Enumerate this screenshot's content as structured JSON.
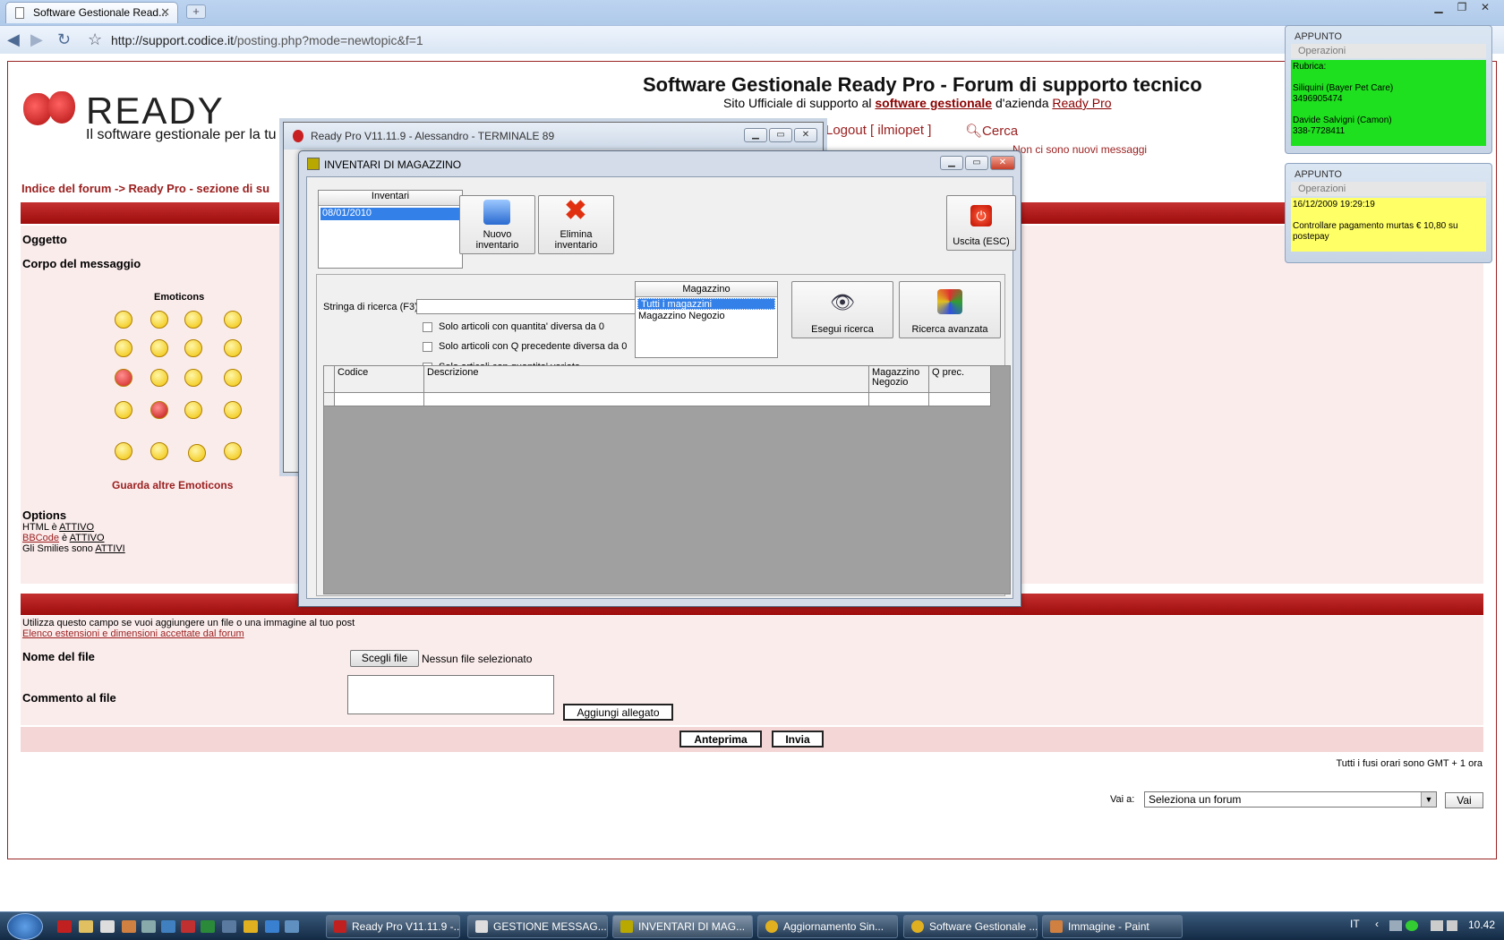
{
  "browser": {
    "tab_title": "Software Gestionale Read...",
    "url_host": "http://support.codice.it",
    "url_path": "/posting.php?mode=newtopic&f=1",
    "tab_close_glyph": "✕",
    "new_tab_glyph": "+",
    "icons": [
      "back-icon",
      "forward-icon",
      "reload-icon",
      "star-icon"
    ]
  },
  "site": {
    "logo_text": "READY",
    "logo_tagline": "Il software gestionale per la tu",
    "title": "Software Gestionale Ready Pro - Forum di supporto tecnico",
    "subtitle_prefix": "Sito Ufficiale di supporto al",
    "subtitle_link1": "software gestionale",
    "subtitle_mid": "d'azienda",
    "subtitle_link2": "Ready Pro",
    "logout": "Logout [ ilmiopet ]",
    "search": "Cerca",
    "no_messages": "Non ci sono nuovi messaggi",
    "breadcrumb": "Indice del forum -> Ready Pro - sezione di su"
  },
  "form": {
    "subject_label": "Oggetto",
    "body_label": "Corpo del messaggio",
    "emoticons_title": "Emoticons",
    "more_emoticons": "Guarda altre Emoticons",
    "options_title": "Options",
    "html_prefix": "HTML è",
    "html_value": "ATTIVO",
    "bbcode_link": "BBCode",
    "bbcode_mid": "è",
    "bbcode_value": "ATTIVO",
    "smilies_prefix": "Gli Smilies sono",
    "smilies_value": "ATTIVI",
    "upload_info": "Utilizza questo campo se vuoi aggiungere un file o una immagine al tuo post",
    "upload_link": "Elenco estensioni e dimensioni accettate dal forum",
    "file_label": "Nome del file",
    "file_button": "Scegli file",
    "file_none": "Nessun file selezionato",
    "comment_label": "Commento al file",
    "add_attachment": "Aggiungi allegato",
    "preview": "Anteprima",
    "submit": "Invia",
    "timezone": "Tutti i fusi orari sono GMT + 1 ora",
    "goto_label": "Vai a:",
    "goto_value": "Seleziona un forum",
    "goto_button": "Vai"
  },
  "appunti": [
    {
      "title": "APPUNTO",
      "ops": "Operazioni",
      "body": "Rubrica:\n\nSiliquini (Bayer Pet Care)\n3496905474\n\nDavide Salvigni (Camon)\n338-7728411",
      "color": "#1ee01e"
    },
    {
      "title": "APPUNTO",
      "ops": "Operazioni",
      "body": "16/12/2009 19:29:19\n\nControllare pagamento murtas € 10,80 su postepay",
      "color": "#ffff66"
    }
  ],
  "readypro": {
    "title": "Ready Pro V11.11.9 - Alessandro - TERMINALE 89"
  },
  "inventari": {
    "title": "INVENTARI DI MAGAZZINO",
    "list_header": "Inventari",
    "list_items": [
      "08/01/2010"
    ],
    "new_line1": "Nuovo",
    "new_line2": "inventario",
    "delete_line1": "Elimina",
    "delete_line2": "inventario",
    "exit": "Uscita (ESC)",
    "search_label": "Stringa di ricerca (F3)",
    "search_value": "",
    "check1": "Solo articoli con quantita' diversa da 0",
    "check2": "Solo articoli con Q precedente diversa da 0",
    "check3": "Solo articoli con quantita' variata",
    "magazzino_header": "Magazzino",
    "magazzini": [
      "Tutti i magazzini",
      "Magazzino Negozio"
    ],
    "run_search": "Esegui ricerca",
    "advanced_search": "Ricerca avanzata",
    "columns": [
      "Codice",
      "Descrizione",
      "Magazzino Negozio",
      "Q prec."
    ]
  },
  "taskbar": {
    "items": [
      "Ready Pro V11.11.9 -...",
      "GESTIONE MESSAG...",
      "INVENTARI DI MAG...",
      "Aggiornamento Sin...",
      "Software Gestionale ...",
      "Immagine - Paint"
    ],
    "lang": "IT",
    "clock": "10.42"
  }
}
